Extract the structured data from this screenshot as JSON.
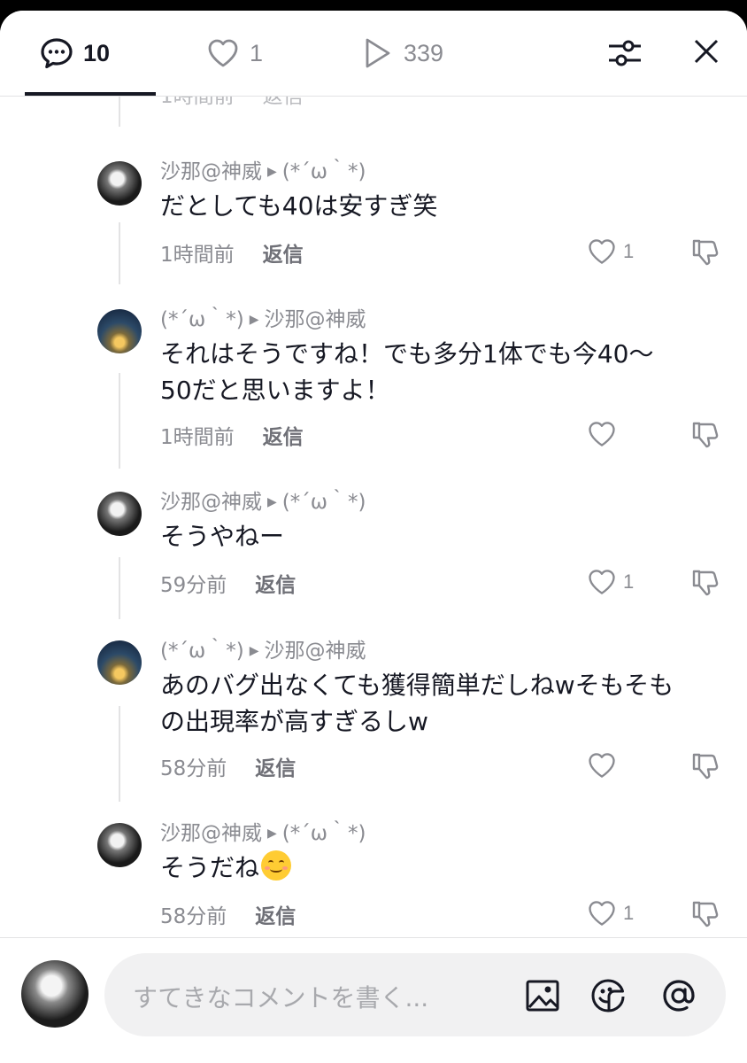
{
  "header": {
    "comments_count": "10",
    "likes_count": "1",
    "views_count": "339"
  },
  "partial_top": {
    "time": "1時間前",
    "reply": "返信"
  },
  "replies": [
    {
      "from": "沙那@神威",
      "to": "(*´ω｀*)",
      "text": "だとしても40は安すぎ笑",
      "time": "1時間前",
      "reply_label": "返信",
      "likes": "1"
    },
    {
      "from": "(*´ω｀*)",
      "to": "沙那@神威",
      "text_line1": "それはそうですね！でも多分1体でも今40〜",
      "text_line2": "50だと思いますよ！",
      "time": "1時間前",
      "reply_label": "返信",
      "likes": ""
    },
    {
      "from": "沙那@神威",
      "to": "(*´ω｀*)",
      "text": "そうやねー",
      "time": "59分前",
      "reply_label": "返信",
      "likes": "1"
    },
    {
      "from": "(*´ω｀*)",
      "to": "沙那@神威",
      "text_line1": "あのバグ出なくても獲得簡単だしねwそもそも",
      "text_line2": "の出現率が高すぎるしw",
      "time": "58分前",
      "reply_label": "返信",
      "likes": ""
    },
    {
      "from": "沙那@神威",
      "to": "(*´ω｀*)",
      "text": "そうだね",
      "time": "58分前",
      "reply_label": "返信",
      "likes": "1"
    }
  ],
  "composer": {
    "placeholder": "すてきなコメントを書く..."
  },
  "icons": {
    "comments": "comment-bubble-icon",
    "likes": "heart-icon",
    "views": "play-icon",
    "filter": "sliders-icon",
    "close": "close-icon",
    "image": "image-icon",
    "sticker": "sticker-icon",
    "mention": "at-icon"
  }
}
